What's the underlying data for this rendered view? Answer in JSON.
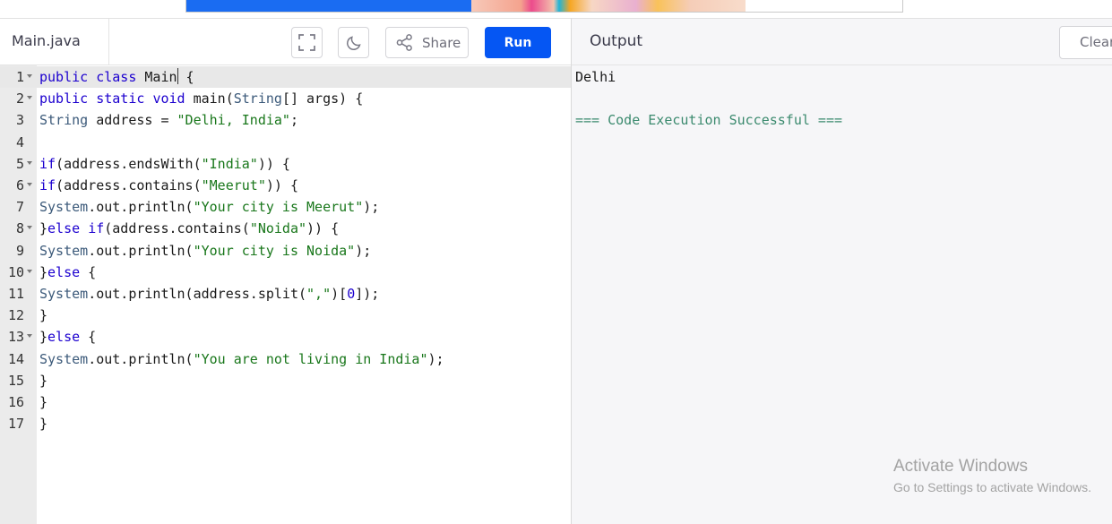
{
  "editor": {
    "file_name": "Main.java",
    "buttons": {
      "fullscreen_icon": "fullscreen-icon",
      "theme_icon": "moon-icon",
      "share_label": "Share",
      "run_label": "Run"
    },
    "lines": [
      {
        "n": "1",
        "fold": true
      },
      {
        "n": "2",
        "fold": true
      },
      {
        "n": "3",
        "fold": false
      },
      {
        "n": "4",
        "fold": false
      },
      {
        "n": "5",
        "fold": true
      },
      {
        "n": "6",
        "fold": true
      },
      {
        "n": "7",
        "fold": false
      },
      {
        "n": "8",
        "fold": true
      },
      {
        "n": "9",
        "fold": false
      },
      {
        "n": "10",
        "fold": true
      },
      {
        "n": "11",
        "fold": false
      },
      {
        "n": "12",
        "fold": false
      },
      {
        "n": "13",
        "fold": true
      },
      {
        "n": "14",
        "fold": false
      },
      {
        "n": "15",
        "fold": false
      },
      {
        "n": "16",
        "fold": false
      },
      {
        "n": "17",
        "fold": false
      }
    ],
    "code": [
      "public class Main {",
      "public static void main(String[] args) {",
      "String address = \"Delhi, India\";",
      "",
      "if(address.endsWith(\"India\")) {",
      "if(address.contains(\"Meerut\")) {",
      "System.out.println(\"Your city is Meerut\");",
      "}else if(address.contains(\"Noida\")) {",
      "System.out.println(\"Your city is Noida\");",
      "}else {",
      "System.out.println(address.split(\",\")[0]);",
      "}",
      "}else {",
      "System.out.println(\"You are not living in India\");",
      "}",
      "}",
      "}"
    ]
  },
  "output": {
    "title": "Output",
    "clear_label": "Clear",
    "lines": [
      "Delhi",
      "",
      "=== Code Execution Successful ==="
    ]
  },
  "watermark": {
    "line1": "Activate Windows",
    "line2": "Go to Settings to activate Windows."
  },
  "colors": {
    "run_button": "#0556f3",
    "keyword": "#1c00cf",
    "string": "#19771b",
    "success": "#3b8a6e"
  }
}
